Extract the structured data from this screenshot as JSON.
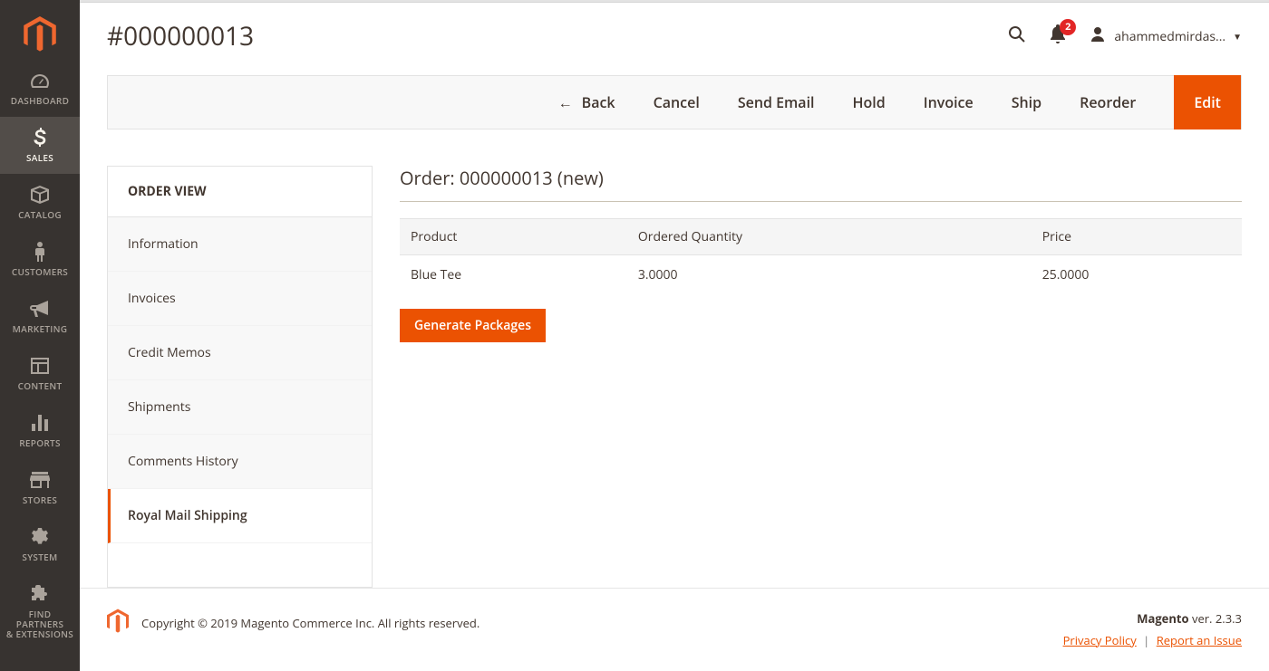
{
  "sidebar": {
    "items": [
      {
        "label": "DASHBOARD",
        "icon": "dashboard"
      },
      {
        "label": "SALES",
        "icon": "dollar"
      },
      {
        "label": "CATALOG",
        "icon": "box"
      },
      {
        "label": "CUSTOMERS",
        "icon": "person"
      },
      {
        "label": "MARKETING",
        "icon": "megaphone"
      },
      {
        "label": "CONTENT",
        "icon": "layout"
      },
      {
        "label": "REPORTS",
        "icon": "bars"
      },
      {
        "label": "STORES",
        "icon": "storefront"
      },
      {
        "label": "SYSTEM",
        "icon": "gear"
      },
      {
        "label": "FIND PARTNERS\n& EXTENSIONS",
        "icon": "puzzle"
      }
    ],
    "active_index": 1
  },
  "header": {
    "title": "#000000013",
    "notifications_count": "2",
    "username": "ahammedmirdas..."
  },
  "actions": {
    "back": "Back",
    "items": [
      "Cancel",
      "Send Email",
      "Hold",
      "Invoice",
      "Ship",
      "Reorder"
    ],
    "primary": "Edit"
  },
  "order_view": {
    "heading": "ORDER VIEW",
    "tabs": [
      "Information",
      "Invoices",
      "Credit Memos",
      "Shipments",
      "Comments History",
      "Royal Mail Shipping"
    ],
    "active_index": 5
  },
  "order": {
    "title": "Order: 000000013 (new)",
    "columns": [
      "Product",
      "Ordered Quantity",
      "Price"
    ],
    "rows": [
      {
        "product": "Blue Tee",
        "qty": "3.0000",
        "price": "25.0000"
      }
    ],
    "generate_label": "Generate Packages"
  },
  "footer": {
    "copyright": "Copyright © 2019 Magento Commerce Inc. All rights reserved.",
    "brand": "Magento",
    "version_prefix": " ver. ",
    "version": "2.3.3",
    "privacy": "Privacy Policy",
    "report": "Report an Issue"
  }
}
